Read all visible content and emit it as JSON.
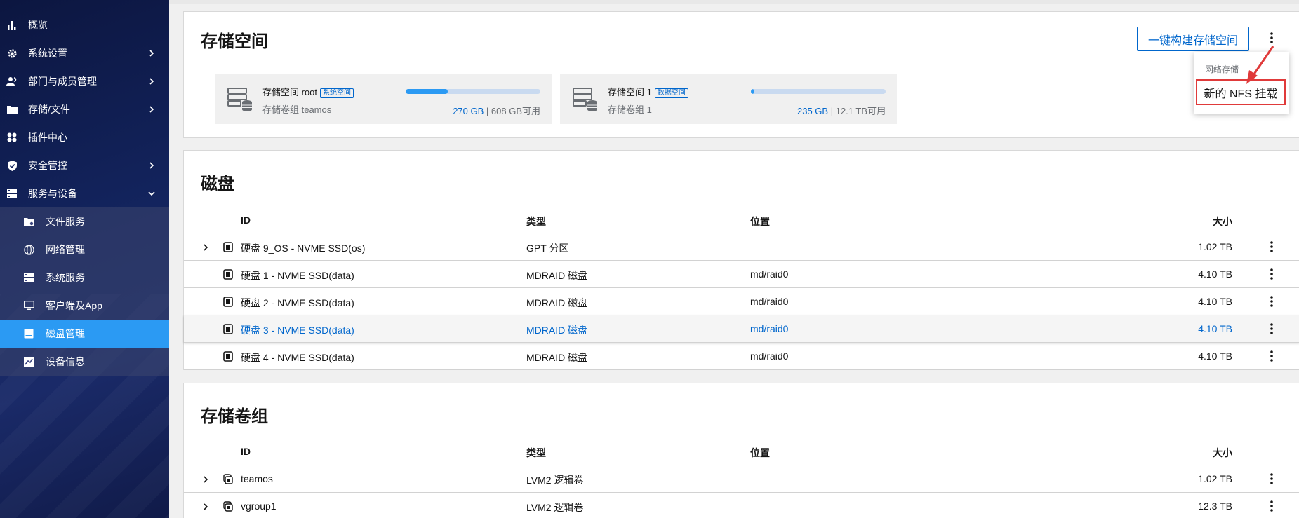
{
  "sidebar": {
    "items": [
      {
        "label": "概览",
        "icon": "bar-chart-icon"
      },
      {
        "label": "系统设置",
        "icon": "gear-icon"
      },
      {
        "label": "部门与成员管理",
        "icon": "users-icon"
      },
      {
        "label": "存储/文件",
        "icon": "folder-icon"
      },
      {
        "label": "插件中心",
        "icon": "plugins-icon"
      },
      {
        "label": "安全管控",
        "icon": "shield-icon"
      },
      {
        "label": "服务与设备",
        "icon": "server-icon"
      }
    ],
    "subitems": [
      {
        "label": "文件服务",
        "icon": "folder-share-icon"
      },
      {
        "label": "网络管理",
        "icon": "globe-icon"
      },
      {
        "label": "系统服务",
        "icon": "server-icon"
      },
      {
        "label": "客户端及App",
        "icon": "monitor-icon"
      },
      {
        "label": "磁盘管理",
        "icon": "disk-icon"
      },
      {
        "label": "设备信息",
        "icon": "chart-box-icon"
      }
    ],
    "active": "磁盘管理"
  },
  "storage": {
    "title": "存储空间",
    "build_button": "一键构建存储空间",
    "spaces": [
      {
        "name": "存储空间 root",
        "badge": "系统空间",
        "group": "存储卷组 teamos",
        "used": "270 GB",
        "available": "| 608 GB可用",
        "usage": 0.31
      },
      {
        "name": "存储空间 1",
        "badge": "数据空间",
        "group": "存储卷组 1",
        "used": "235 GB",
        "available": "| 12.1 TB可用",
        "usage": 0.02
      }
    ]
  },
  "dropdown": {
    "header": "网络存储",
    "item": "新的 NFS 挂载"
  },
  "disks": {
    "title": "磁盘",
    "columns": [
      "ID",
      "类型",
      "位置",
      "大小"
    ],
    "rows": [
      {
        "id": "硬盘 9_OS - NVME SSD(os)",
        "type": "GPT 分区",
        "location": "",
        "size": "1.02 TB",
        "expandable": true
      },
      {
        "id": "硬盘 1 - NVME SSD(data)",
        "type": "MDRAID 磁盘",
        "location": "md/raid0",
        "size": "4.10 TB",
        "expandable": false
      },
      {
        "id": "硬盘 2 - NVME SSD(data)",
        "type": "MDRAID 磁盘",
        "location": "md/raid0",
        "size": "4.10 TB",
        "expandable": false
      },
      {
        "id": "硬盘 3 - NVME SSD(data)",
        "type": "MDRAID 磁盘",
        "location": "md/raid0",
        "size": "4.10 TB",
        "expandable": false
      },
      {
        "id": "硬盘 4 - NVME SSD(data)",
        "type": "MDRAID 磁盘",
        "location": "md/raid0",
        "size": "4.10 TB",
        "expandable": false
      }
    ]
  },
  "volume_groups": {
    "title": "存储卷组",
    "columns": [
      "ID",
      "类型",
      "位置",
      "大小"
    ],
    "rows": [
      {
        "id": "teamos",
        "type": "LVM2 逻辑卷",
        "location": "",
        "size": "1.02 TB"
      },
      {
        "id": "vgroup1",
        "type": "LVM2 逻辑卷",
        "location": "",
        "size": "12.3 TB"
      }
    ]
  },
  "colors": {
    "accent": "#2b9af3",
    "link": "#0066cc",
    "highlight_border": "#e03a3a",
    "sidebar_bg": "#13245e"
  }
}
